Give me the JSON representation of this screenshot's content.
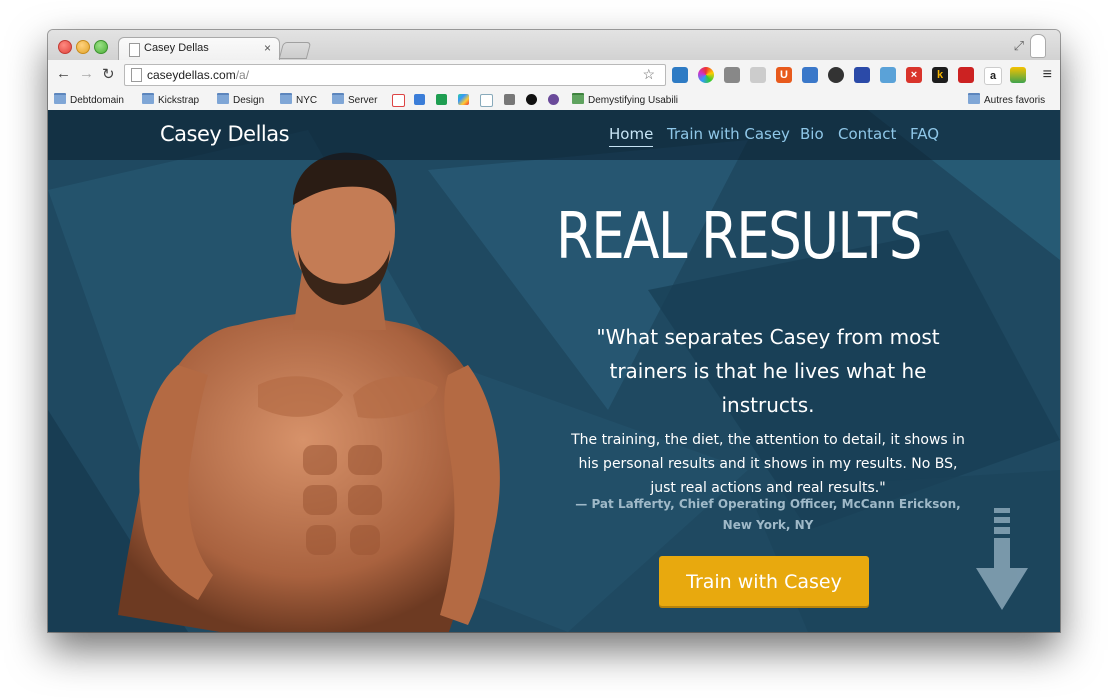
{
  "browser": {
    "tab_title": "Casey Dellas",
    "tab_close": "×",
    "url_host": "caseydellas.com",
    "url_path": "/a/",
    "bookmarks": [
      "Debtdomain",
      "Kickstrap",
      "Design",
      "NYC",
      "Server",
      "Demystifying Usabili",
      "Autres favoris"
    ]
  },
  "site": {
    "brand": "Casey Dellas",
    "nav": [
      "Home",
      "Train with Casey",
      "Bio",
      "Contact",
      "FAQ"
    ],
    "headline": "REAL RESULTS",
    "quote_lead": "\"What separates Casey from most trainers is that he lives what he instructs.",
    "quote_body": "The training, the diet, the attention to detail, it shows in his personal results and it shows in my results. No BS, just real actions and real results.\"",
    "attribution": "— Pat Lafferty, Chief Operating Officer, McCann Erickson, New York, NY",
    "cta_label": "Train with Casey"
  },
  "colors": {
    "page_bg": "#1f4961",
    "nav_link": "#8fc7e8",
    "cta": "#e8a90e"
  }
}
